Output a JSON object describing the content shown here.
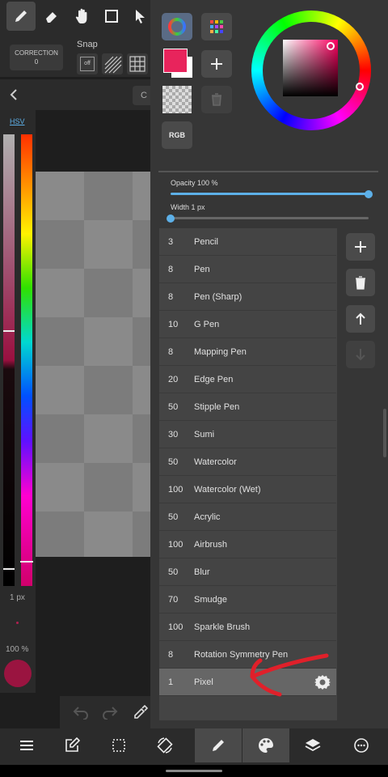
{
  "toolbar": {
    "correction_label": "CORRECTION",
    "correction_value": "0",
    "snap_label": "Snap",
    "snap_off": "off"
  },
  "canvas_tab_partial": "C",
  "color_panel": {
    "mode_label": "HSV",
    "size_label": "1 px",
    "opacity_label": "100 %"
  },
  "colors": {
    "main": "#e8245c",
    "sub": "#ffffff",
    "accent": "#5db0e8",
    "annotation": "#e0202a"
  },
  "color_buttons": {
    "rgb_label": "RGB"
  },
  "brush_settings": {
    "opacity_label": "Opacity 100 %",
    "opacity_value": 1.0,
    "width_label": "Width 1 px",
    "width_value": 0.0
  },
  "brushes": [
    {
      "width": "3",
      "name": "Pencil"
    },
    {
      "width": "8",
      "name": "Pen"
    },
    {
      "width": "8",
      "name": "Pen (Sharp)"
    },
    {
      "width": "10",
      "name": "G Pen"
    },
    {
      "width": "8",
      "name": "Mapping Pen"
    },
    {
      "width": "20",
      "name": "Edge Pen"
    },
    {
      "width": "50",
      "name": "Stipple Pen"
    },
    {
      "width": "30",
      "name": "Sumi"
    },
    {
      "width": "50",
      "name": "Watercolor"
    },
    {
      "width": "100",
      "name": "Watercolor (Wet)"
    },
    {
      "width": "50",
      "name": "Acrylic"
    },
    {
      "width": "100",
      "name": "Airbrush"
    },
    {
      "width": "50",
      "name": "Blur"
    },
    {
      "width": "70",
      "name": "Smudge"
    },
    {
      "width": "100",
      "name": "Sparkle Brush"
    },
    {
      "width": "8",
      "name": "Rotation Symmetry Pen"
    },
    {
      "width": "1",
      "name": "Pixel",
      "selected": true
    }
  ],
  "icons": {
    "top": [
      "pen-icon",
      "eraser-icon",
      "hand-icon",
      "select-rect-icon",
      "arrow-icon"
    ],
    "bottom": [
      "menu-icon",
      "edit-icon",
      "selection-icon",
      "rotate-icon",
      "brush-icon",
      "palette-icon",
      "layers-icon",
      "more-icon"
    ]
  }
}
